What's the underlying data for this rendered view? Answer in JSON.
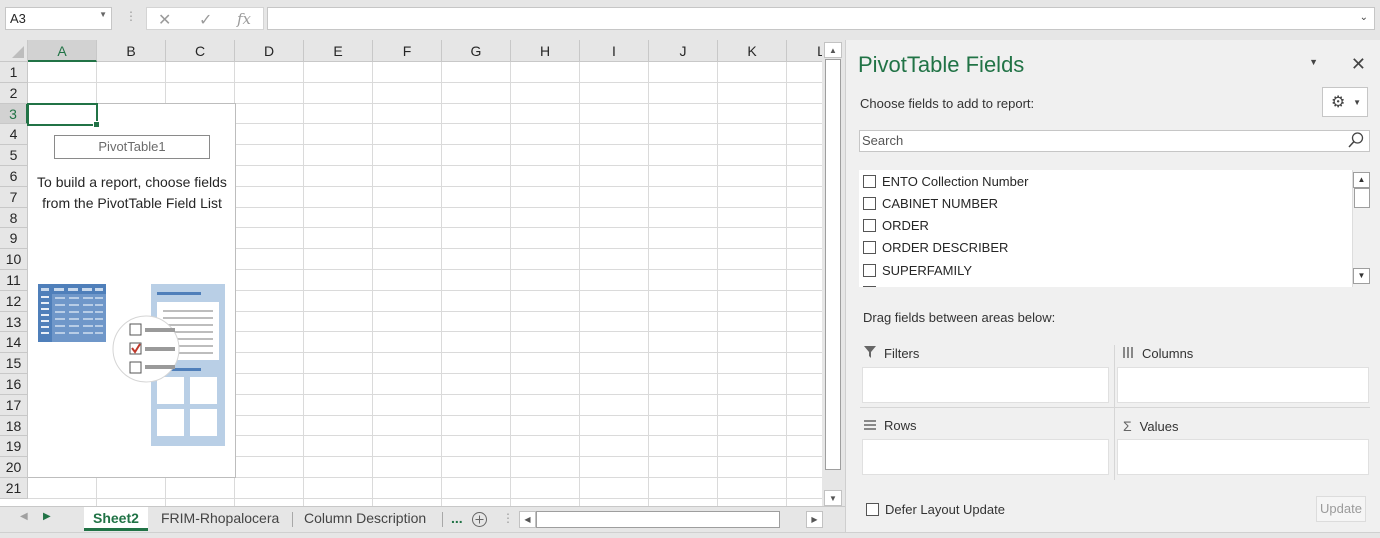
{
  "formula_bar": {
    "name_box": "A3",
    "formula": "",
    "cancel_icon": "✕",
    "enter_icon": "✓",
    "function_icon": "fx"
  },
  "grid": {
    "columns": [
      "A",
      "B",
      "C",
      "D",
      "E",
      "F",
      "G",
      "H",
      "I",
      "J",
      "K",
      "L"
    ],
    "rows": [
      "1",
      "2",
      "3",
      "4",
      "5",
      "6",
      "7",
      "8",
      "9",
      "10",
      "11",
      "12",
      "13",
      "14",
      "15",
      "16",
      "17",
      "18",
      "19",
      "20",
      "21"
    ],
    "selected_column": "A",
    "selected_row": "3"
  },
  "pivot_placeholder": {
    "name": "PivotTable1",
    "message": "To build a report, choose fields from the PivotTable Field List"
  },
  "sheet_tabs": {
    "tabs": [
      "Sheet2",
      "FRIM-Rhopalocera",
      "Column Description"
    ],
    "active": "Sheet2",
    "more": "..."
  },
  "panel": {
    "title": "PivotTable Fields",
    "choose_label": "Choose fields to add to report:",
    "search_placeholder": "Search",
    "fields": [
      "ENTO Collection Number",
      "CABINET NUMBER",
      "ORDER",
      "ORDER DESCRIBER",
      "SUPERFAMILY"
    ],
    "drag_label": "Drag fields between areas below:",
    "areas": {
      "filters": "Filters",
      "columns": "Columns",
      "rows": "Rows",
      "values": "Values"
    },
    "defer_label": "Defer Layout Update",
    "update_label": "Update"
  }
}
